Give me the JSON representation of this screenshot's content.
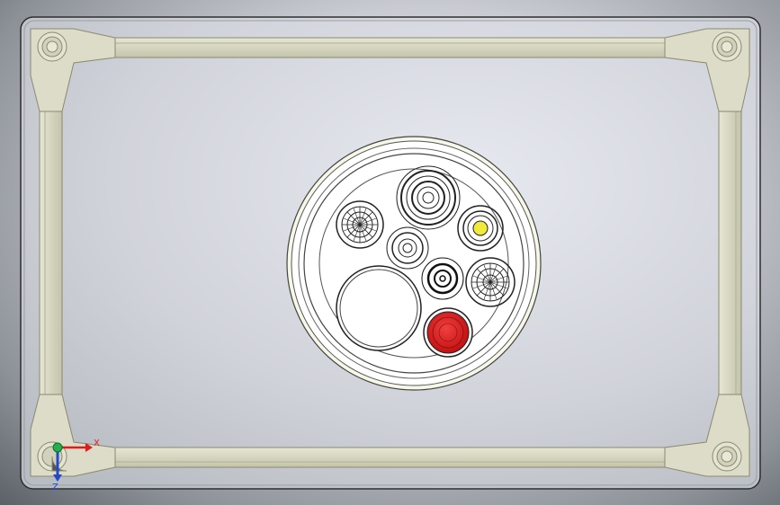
{
  "colors": {
    "background_center": "#e3e6ec",
    "background_edge": "#5c6067",
    "plate": "#d6d9df",
    "frame": "#dcdcc8",
    "frame_edge": "#8a8a70",
    "cover_white": "#ffffff",
    "component_red": "#e01b1b",
    "component_yellow": "#f2ea3a",
    "axis_x": "#e01b1b",
    "axis_y": "#23b04a",
    "axis_z": "#2349c8"
  },
  "triad": {
    "x_label": "X",
    "z_label": "Z"
  },
  "icons": {
    "triad": "coordinate-triad-icon"
  }
}
